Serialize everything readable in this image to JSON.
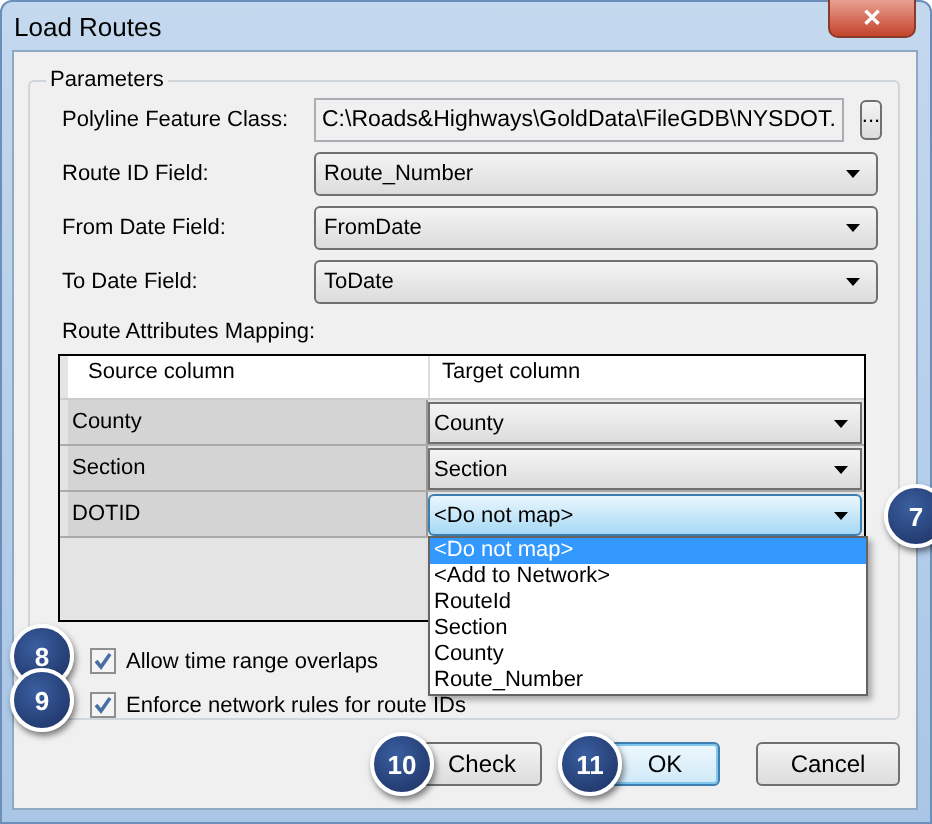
{
  "window": {
    "title": "Load Routes",
    "close": "✕"
  },
  "group": {
    "title": "Parameters"
  },
  "fields": [
    {
      "kind": "text",
      "label": "Polyline Feature Class:",
      "value": "C:\\Roads&Highways\\GoldData\\FileGDB\\NYSDOT.",
      "browse": "..."
    },
    {
      "kind": "combo",
      "label": "Route ID Field:",
      "value": "Route_Number"
    },
    {
      "kind": "combo",
      "label": "From Date Field:",
      "value": "FromDate"
    },
    {
      "kind": "combo",
      "label": "To Date Field:",
      "value": "ToDate"
    }
  ],
  "mapping": {
    "label": "Route Attributes Mapping:",
    "columns": [
      "Source column",
      "Target column"
    ],
    "rows": [
      {
        "source": "County",
        "target": "County",
        "focused": false
      },
      {
        "source": "Section",
        "target": "Section",
        "focused": false
      },
      {
        "source": "DOTID",
        "target": "<Do not map>",
        "focused": true,
        "callout": "7"
      }
    ],
    "dropdown": [
      {
        "label": "<Do not map>",
        "selected": true
      },
      {
        "label": "<Add to Network>",
        "selected": false
      },
      {
        "label": "RouteId",
        "selected": false
      },
      {
        "label": "Section",
        "selected": false
      },
      {
        "label": "County",
        "selected": false
      },
      {
        "label": "Route_Number",
        "selected": false
      }
    ]
  },
  "checkboxes": [
    {
      "label": "Allow time range overlaps",
      "checked": true,
      "callout": "8"
    },
    {
      "label": "Enforce network rules for route IDs",
      "checked": true,
      "callout": "9"
    }
  ],
  "buttons": [
    {
      "label": "Check",
      "default": false,
      "callout": "10"
    },
    {
      "label": "OK",
      "default": true,
      "callout": "11"
    },
    {
      "label": "Cancel",
      "default": false
    }
  ]
}
